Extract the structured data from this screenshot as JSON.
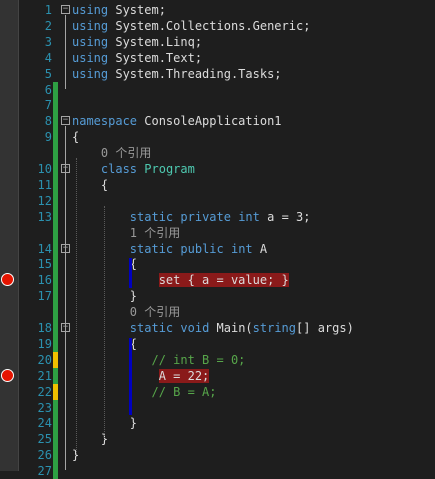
{
  "editor": {
    "lines": [
      {
        "n": "1",
        "tokens": [
          {
            "t": "using",
            "c": "kw"
          },
          {
            "t": " System;",
            "c": ""
          }
        ]
      },
      {
        "n": "2",
        "tokens": [
          {
            "t": "using",
            "c": "kw"
          },
          {
            "t": " System.Collections.Generic;",
            "c": ""
          }
        ]
      },
      {
        "n": "3",
        "tokens": [
          {
            "t": "using",
            "c": "kw"
          },
          {
            "t": " System.Linq;",
            "c": ""
          }
        ]
      },
      {
        "n": "4",
        "tokens": [
          {
            "t": "using",
            "c": "kw"
          },
          {
            "t": " System.Text;",
            "c": ""
          }
        ]
      },
      {
        "n": "5",
        "tokens": [
          {
            "t": "using",
            "c": "kw"
          },
          {
            "t": " System.Threading.Tasks;",
            "c": ""
          }
        ]
      },
      {
        "n": "6",
        "tokens": []
      },
      {
        "n": "7",
        "tokens": []
      },
      {
        "n": "8",
        "tokens": [
          {
            "t": "namespace",
            "c": "kw"
          },
          {
            "t": " ConsoleApplication1",
            "c": ""
          }
        ]
      },
      {
        "n": "9",
        "tokens": [
          {
            "t": "{",
            "c": ""
          }
        ]
      },
      {
        "lens": "0 个引用",
        "tokens": [
          {
            "t": "    0 个引用",
            "c": "lens"
          }
        ]
      },
      {
        "n": "10",
        "tokens": [
          {
            "t": "    ",
            "c": ""
          },
          {
            "t": "class",
            "c": "kw"
          },
          {
            "t": " ",
            "c": ""
          },
          {
            "t": "Program",
            "c": "ty"
          }
        ]
      },
      {
        "n": "11",
        "tokens": [
          {
            "t": "    {",
            "c": ""
          }
        ]
      },
      {
        "n": "12",
        "tokens": []
      },
      {
        "n": "13",
        "tokens": [
          {
            "t": "        ",
            "c": ""
          },
          {
            "t": "static",
            "c": "kw"
          },
          {
            "t": " ",
            "c": ""
          },
          {
            "t": "private",
            "c": "kw"
          },
          {
            "t": " ",
            "c": ""
          },
          {
            "t": "int",
            "c": "kw"
          },
          {
            "t": " a = 3;",
            "c": ""
          }
        ]
      },
      {
        "lens": "1 个引用",
        "tokens": [
          {
            "t": "        1 个引用",
            "c": "lens"
          }
        ]
      },
      {
        "n": "14",
        "tokens": [
          {
            "t": "        ",
            "c": ""
          },
          {
            "t": "static",
            "c": "kw"
          },
          {
            "t": " ",
            "c": ""
          },
          {
            "t": "public",
            "c": "kw"
          },
          {
            "t": " ",
            "c": ""
          },
          {
            "t": "int",
            "c": "kw"
          },
          {
            "t": " A",
            "c": ""
          }
        ]
      },
      {
        "n": "15",
        "tokens": [
          {
            "t": "        {",
            "c": ""
          }
        ]
      },
      {
        "n": "16",
        "tokens": [
          {
            "t": "            ",
            "c": ""
          },
          {
            "t": "set { a = value; }",
            "c": "hl"
          }
        ]
      },
      {
        "n": "17",
        "tokens": [
          {
            "t": "        }",
            "c": ""
          }
        ]
      },
      {
        "lens": "0 个引用",
        "tokens": [
          {
            "t": "        0 个引用",
            "c": "lens"
          }
        ]
      },
      {
        "n": "18",
        "tokens": [
          {
            "t": "        ",
            "c": ""
          },
          {
            "t": "static",
            "c": "kw"
          },
          {
            "t": " ",
            "c": ""
          },
          {
            "t": "void",
            "c": "kw"
          },
          {
            "t": " Main(",
            "c": ""
          },
          {
            "t": "string",
            "c": "kw"
          },
          {
            "t": "[] args)",
            "c": ""
          }
        ]
      },
      {
        "n": "19",
        "tokens": [
          {
            "t": "        {",
            "c": ""
          }
        ]
      },
      {
        "n": "20",
        "tokens": [
          {
            "t": "           ",
            "c": ""
          },
          {
            "t": "// int B = 0;",
            "c": "cm"
          }
        ]
      },
      {
        "n": "21",
        "tokens": [
          {
            "t": "            ",
            "c": ""
          },
          {
            "t": "A = 22;",
            "c": "hl"
          }
        ]
      },
      {
        "n": "22",
        "tokens": [
          {
            "t": "           ",
            "c": ""
          },
          {
            "t": "// B = A;",
            "c": "cm"
          }
        ]
      },
      {
        "n": "23",
        "tokens": []
      },
      {
        "n": "24",
        "tokens": [
          {
            "t": "        }",
            "c": ""
          }
        ]
      },
      {
        "n": "25",
        "tokens": [
          {
            "t": "    }",
            "c": ""
          }
        ]
      },
      {
        "n": "26",
        "tokens": [
          {
            "t": "}",
            "c": ""
          }
        ]
      },
      {
        "n": "27",
        "tokens": []
      }
    ],
    "change_colors": {
      "saved": "#2ea043",
      "unsaved": "#f0c000"
    },
    "breakpoint_color": "#e51400",
    "fold_glyph": "−"
  }
}
